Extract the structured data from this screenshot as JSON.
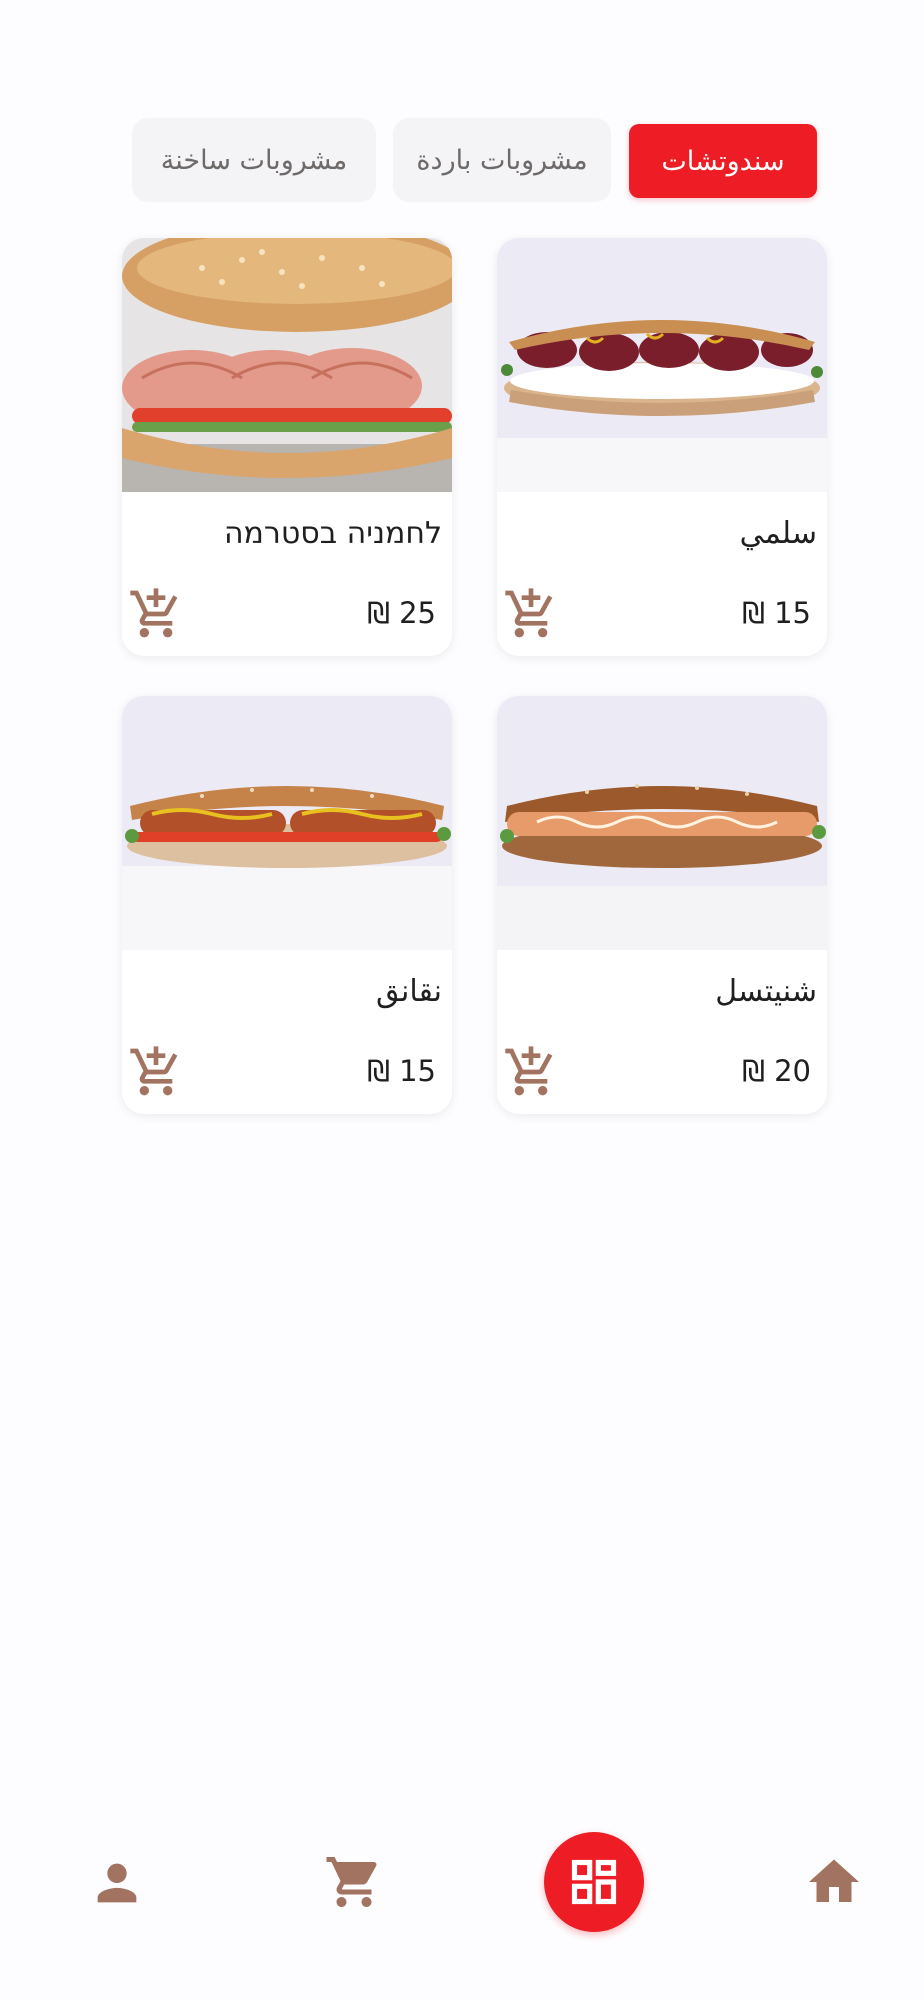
{
  "colors": {
    "accent": "#ee1c25",
    "icon": "#a27360",
    "tab_inactive_bg": "#f4f4f6",
    "tab_inactive_text": "#6f6a6a"
  },
  "tabs": [
    {
      "label": "سندوتشات",
      "active": true
    },
    {
      "label": "مشروبات باردة",
      "active": false
    },
    {
      "label": "مشروبات ساخنة",
      "active": false
    }
  ],
  "products": [
    {
      "name": "سلمي",
      "price": "15 ₪",
      "image": "salami-sandwich",
      "cart_icon": "add-shopping-cart-icon"
    },
    {
      "name": "לחמניה בסטרמה",
      "price": "25 ₪",
      "image": "pastrami-roll",
      "cart_icon": "add-shopping-cart-icon"
    },
    {
      "name": "شنيتسل",
      "price": "20 ₪",
      "image": "schnitzel-sandwich",
      "cart_icon": "add-shopping-cart-icon"
    },
    {
      "name": "نقانق",
      "price": "15 ₪",
      "image": "sausage-sandwich",
      "cart_icon": "add-shopping-cart-icon"
    }
  ],
  "bottom_nav": [
    {
      "icon": "person-icon"
    },
    {
      "icon": "shopping-cart-icon"
    },
    {
      "icon": "dashboard-icon",
      "active": true
    },
    {
      "icon": "home-icon"
    }
  ]
}
